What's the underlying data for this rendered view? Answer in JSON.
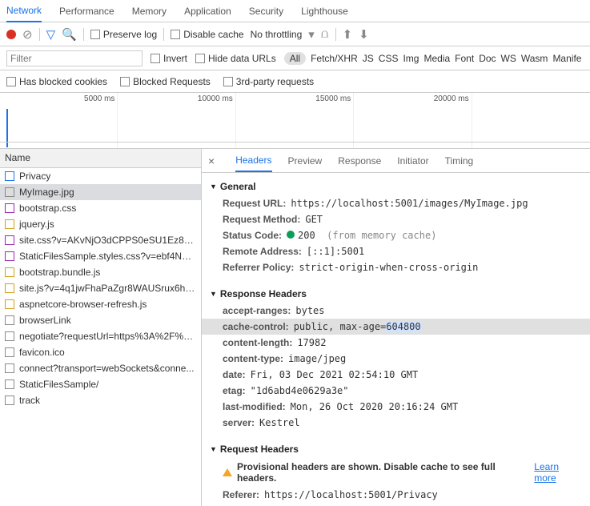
{
  "top_tabs": [
    "Network",
    "Performance",
    "Memory",
    "Application",
    "Security",
    "Lighthouse"
  ],
  "active_top_tab": "Network",
  "toolbar": {
    "preserve_log": "Preserve log",
    "disable_cache": "Disable cache",
    "throttling": "No throttling"
  },
  "filter": {
    "placeholder": "Filter",
    "invert": "Invert",
    "hide_data_urls": "Hide data URLs",
    "types": [
      "All",
      "Fetch/XHR",
      "JS",
      "CSS",
      "Img",
      "Media",
      "Font",
      "Doc",
      "WS",
      "Wasm",
      "Manife"
    ],
    "active_type": "All",
    "blocked_cookies": "Has blocked cookies",
    "blocked_requests": "Blocked Requests",
    "third_party": "3rd-party requests"
  },
  "timeline_labels": [
    "5000 ms",
    "10000 ms",
    "15000 ms",
    "20000 ms"
  ],
  "list_header": "Name",
  "requests": [
    {
      "name": "Privacy",
      "icon": "doc",
      "color": "#1a73e8"
    },
    {
      "name": "MyImage.jpg",
      "icon": "img",
      "color": "#888",
      "selected": true
    },
    {
      "name": "bootstrap.css",
      "icon": "css",
      "color": "#9c27b0"
    },
    {
      "name": "jquery.js",
      "icon": "js",
      "color": "#d4a017"
    },
    {
      "name": "site.css?v=AKvNjO3dCPPS0eSU1Ez8T2...",
      "icon": "css",
      "color": "#9c27b0"
    },
    {
      "name": "StaticFilesSample.styles.css?v=ebf4NvV...",
      "icon": "css",
      "color": "#9c27b0"
    },
    {
      "name": "bootstrap.bundle.js",
      "icon": "js",
      "color": "#d4a017"
    },
    {
      "name": "site.js?v=4q1jwFhaPaZgr8WAUSrux6hA...",
      "icon": "js",
      "color": "#d4a017"
    },
    {
      "name": "aspnetcore-browser-refresh.js",
      "icon": "js",
      "color": "#d4a017"
    },
    {
      "name": "browserLink",
      "icon": "other",
      "color": "#888"
    },
    {
      "name": "negotiate?requestUrl=https%3A%2F%2...",
      "icon": "other",
      "color": "#888"
    },
    {
      "name": "favicon.ico",
      "icon": "other",
      "color": "#888"
    },
    {
      "name": "connect?transport=webSockets&conne...",
      "icon": "other",
      "color": "#888"
    },
    {
      "name": "StaticFilesSample/",
      "icon": "other",
      "color": "#888"
    },
    {
      "name": "track",
      "icon": "other",
      "color": "#888"
    }
  ],
  "detail_tabs": [
    "Headers",
    "Preview",
    "Response",
    "Initiator",
    "Timing"
  ],
  "active_detail_tab": "Headers",
  "general": {
    "title": "General",
    "request_url_k": "Request URL:",
    "request_url_v": "https://localhost:5001/images/MyImage.jpg",
    "request_method_k": "Request Method:",
    "request_method_v": "GET",
    "status_code_k": "Status Code:",
    "status_code_v": "200",
    "status_code_note": "(from memory cache)",
    "remote_addr_k": "Remote Address:",
    "remote_addr_v": "[::1]:5001",
    "referrer_policy_k": "Referrer Policy:",
    "referrer_policy_v": "strict-origin-when-cross-origin"
  },
  "response_headers": {
    "title": "Response Headers",
    "rows": [
      {
        "k": "accept-ranges:",
        "v": "bytes"
      },
      {
        "k": "cache-control:",
        "v_pre": "public, max-age=",
        "v_hl": "604800",
        "highlighted": true
      },
      {
        "k": "content-length:",
        "v": "17982"
      },
      {
        "k": "content-type:",
        "v": "image/jpeg"
      },
      {
        "k": "date:",
        "v": "Fri, 03 Dec 2021 02:54:10 GMT"
      },
      {
        "k": "etag:",
        "v": "\"1d6abd4e0629a3e\""
      },
      {
        "k": "last-modified:",
        "v": "Mon, 26 Oct 2020 20:16:24 GMT"
      },
      {
        "k": "server:",
        "v": "Kestrel"
      }
    ]
  },
  "request_headers": {
    "title": "Request Headers",
    "warning": "Provisional headers are shown. Disable cache to see full headers.",
    "learn_more": "Learn more",
    "referer_k": "Referer:",
    "referer_v": "https://localhost:5001/Privacy"
  }
}
